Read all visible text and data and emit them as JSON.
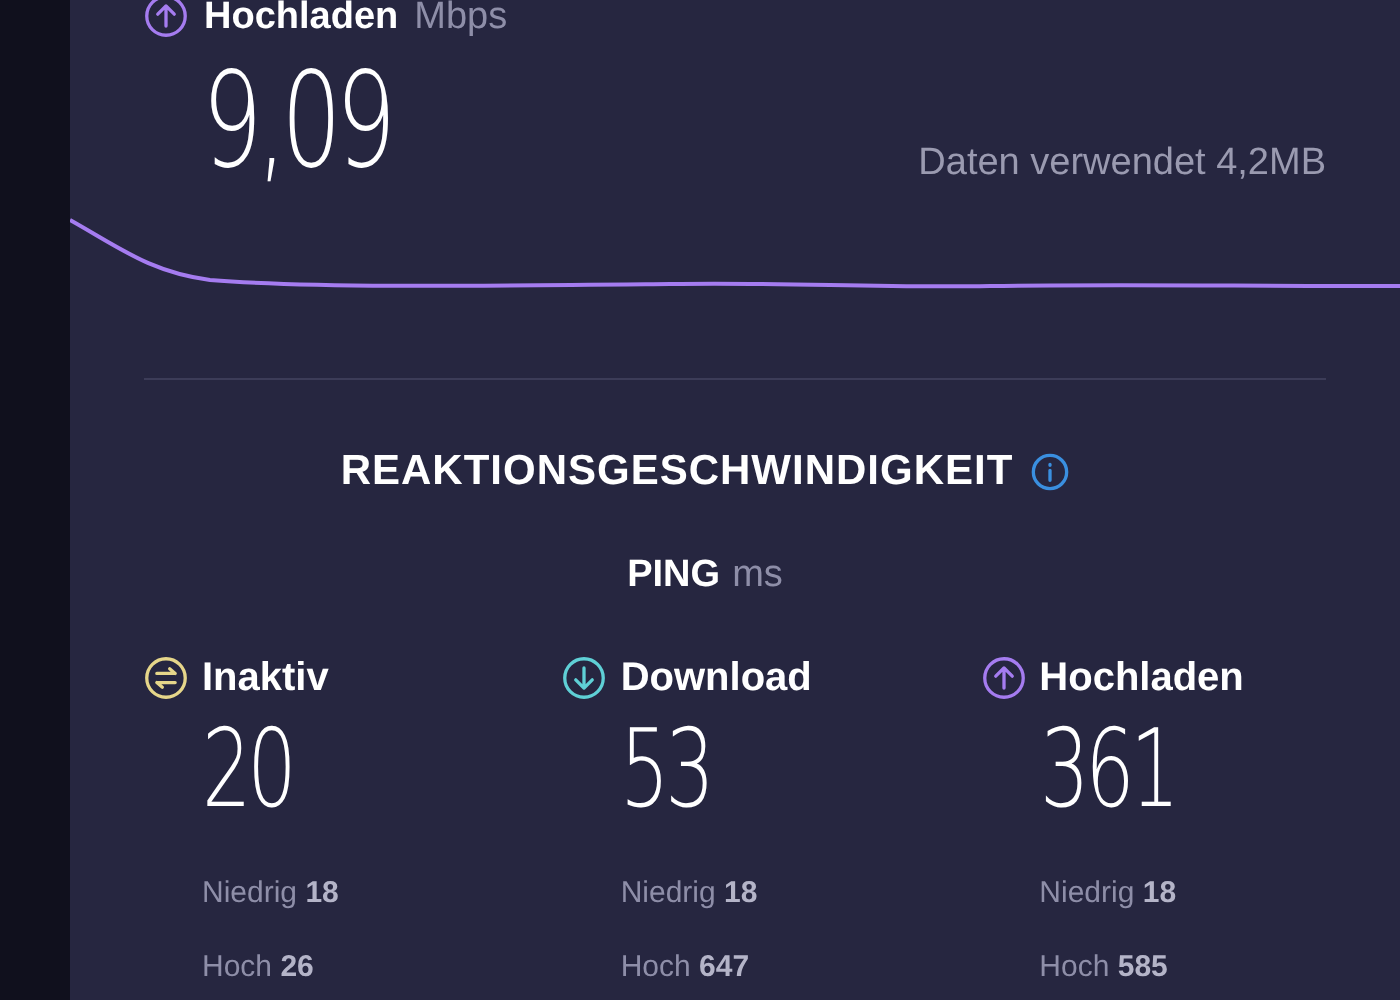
{
  "upload_header": {
    "label": "Hochladen",
    "unit": "Mbps",
    "value": "9,09",
    "data_used": "Daten verwendet 4,2MB"
  },
  "responsiveness": {
    "title": "REAKTIONSGESCHWINDIGKEIT",
    "ping_label": "PING",
    "ping_unit": "ms",
    "columns": [
      {
        "kind": "idle",
        "color": "#e6d68a",
        "label": "Inaktiv",
        "value": "20",
        "low_label": "Niedrig",
        "low": "18",
        "high_label": "Hoch",
        "high": "26"
      },
      {
        "kind": "download",
        "color": "#5fd0d6",
        "label": "Download",
        "value": "53",
        "low_label": "Niedrig",
        "low": "18",
        "high_label": "Hoch",
        "high": "647"
      },
      {
        "kind": "upload",
        "color": "#a57cf0",
        "label": "Hochladen",
        "value": "361",
        "low_label": "Niedrig",
        "low": "18",
        "high_label": "Hoch",
        "high": "585"
      }
    ]
  }
}
